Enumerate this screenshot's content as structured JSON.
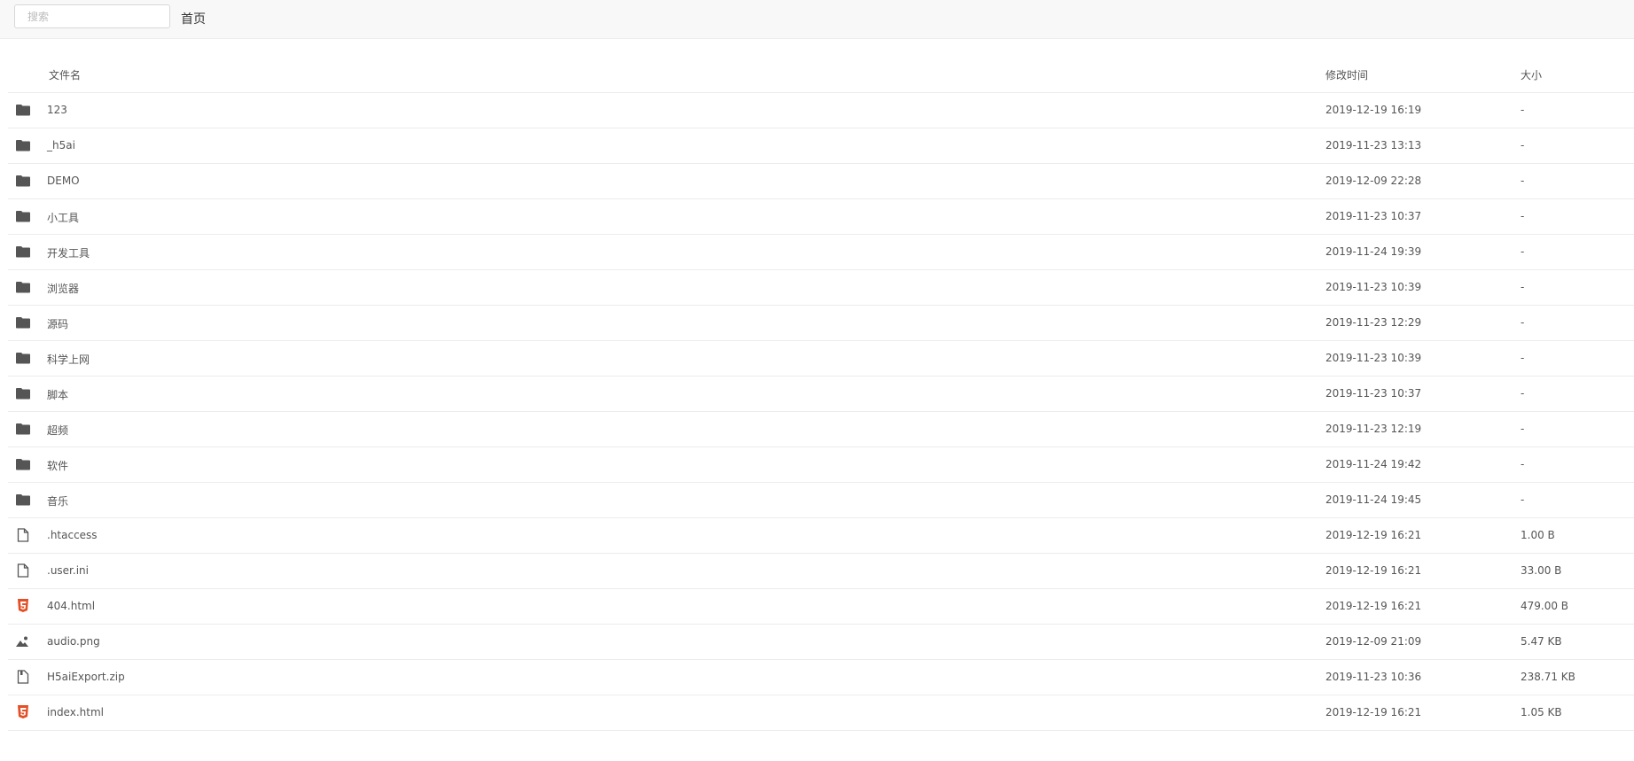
{
  "search": {
    "placeholder": "搜索"
  },
  "breadcrumb": {
    "home": "首页"
  },
  "columns": {
    "name": "文件名",
    "modified": "修改时间",
    "size": "大小"
  },
  "colors": {
    "folder": "#555555",
    "file": "#555555",
    "html5": "#e34f26"
  },
  "items": [
    {
      "name": "123",
      "modified": "2019-12-19 16:19",
      "size": "-",
      "icon": "folder-icon"
    },
    {
      "name": "_h5ai",
      "modified": "2019-11-23 13:13",
      "size": "-",
      "icon": "folder-icon"
    },
    {
      "name": "DEMO",
      "modified": "2019-12-09 22:28",
      "size": "-",
      "icon": "folder-icon"
    },
    {
      "name": "小工具",
      "modified": "2019-11-23 10:37",
      "size": "-",
      "icon": "folder-icon"
    },
    {
      "name": "开发工具",
      "modified": "2019-11-24 19:39",
      "size": "-",
      "icon": "folder-icon"
    },
    {
      "name": "浏览器",
      "modified": "2019-11-23 10:39",
      "size": "-",
      "icon": "folder-icon"
    },
    {
      "name": "源码",
      "modified": "2019-11-23 12:29",
      "size": "-",
      "icon": "folder-icon"
    },
    {
      "name": "科学上网",
      "modified": "2019-11-23 10:39",
      "size": "-",
      "icon": "folder-icon"
    },
    {
      "name": "脚本",
      "modified": "2019-11-23 10:37",
      "size": "-",
      "icon": "folder-icon"
    },
    {
      "name": "超频",
      "modified": "2019-11-23 12:19",
      "size": "-",
      "icon": "folder-icon"
    },
    {
      "name": "软件",
      "modified": "2019-11-24 19:42",
      "size": "-",
      "icon": "folder-icon"
    },
    {
      "name": "音乐",
      "modified": "2019-11-24 19:45",
      "size": "-",
      "icon": "folder-icon"
    },
    {
      "name": ".htaccess",
      "modified": "2019-12-19 16:21",
      "size": "1.00 B",
      "icon": "file-icon"
    },
    {
      "name": ".user.ini",
      "modified": "2019-12-19 16:21",
      "size": "33.00 B",
      "icon": "file-icon"
    },
    {
      "name": "404.html",
      "modified": "2019-12-19 16:21",
      "size": "479.00 B",
      "icon": "html5-icon"
    },
    {
      "name": "audio.png",
      "modified": "2019-12-09 21:09",
      "size": "5.47 KB",
      "icon": "image-icon"
    },
    {
      "name": "H5aiExport.zip",
      "modified": "2019-11-23 10:36",
      "size": "238.71 KB",
      "icon": "archive-icon"
    },
    {
      "name": "index.html",
      "modified": "2019-12-19 16:21",
      "size": "1.05 KB",
      "icon": "html5-icon"
    }
  ]
}
